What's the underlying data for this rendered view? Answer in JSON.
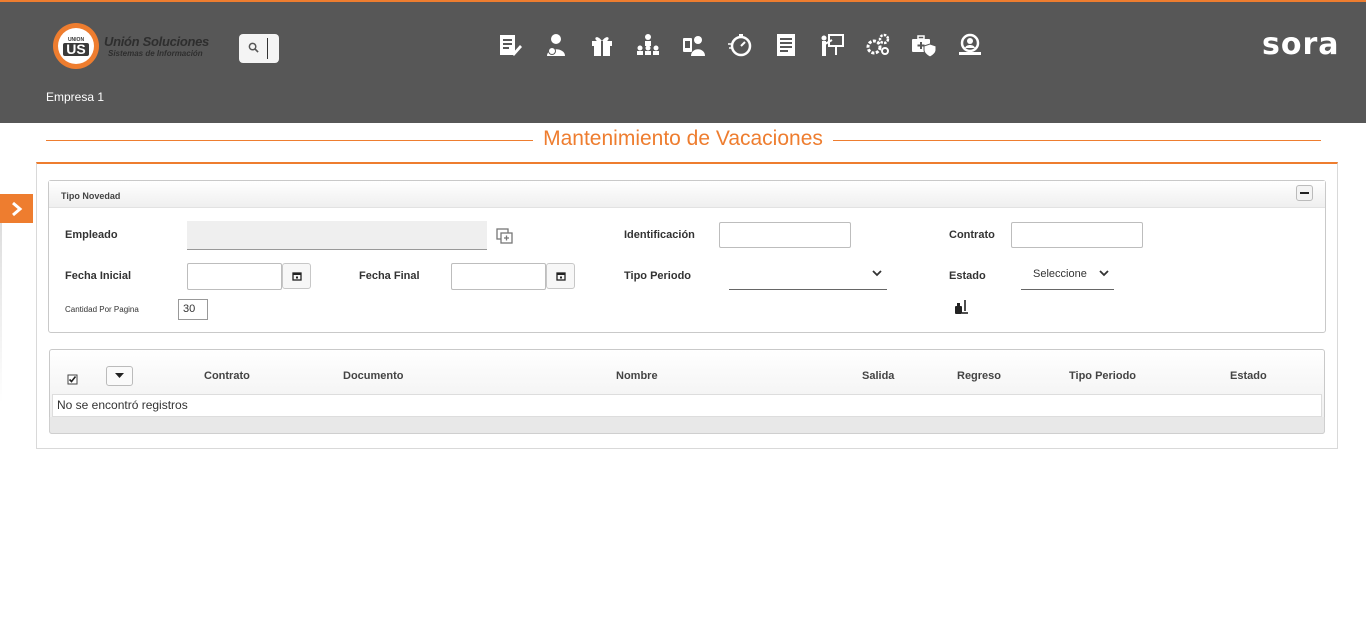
{
  "header": {
    "logo": {
      "badge_small": "UNION",
      "badge_main": "US",
      "title": "Unión Soluciones",
      "subtitle": "Sistemas de Información"
    },
    "brand": "sora",
    "company": "Empresa 1",
    "nav_icons": [
      "document-edit-icon",
      "user-money-icon",
      "gift-icon",
      "org-chart-icon",
      "person-phone-icon",
      "stopwatch-icon",
      "report-list-icon",
      "presentation-icon",
      "gears-icon",
      "medical-shield-icon",
      "search-people-icon"
    ]
  },
  "page": {
    "title": "Mantenimiento de Vacaciones"
  },
  "filter_panel": {
    "title": "Tipo Novedad",
    "labels": {
      "empleado": "Empleado",
      "identificacion": "Identificación",
      "contrato": "Contrato",
      "fecha_inicial": "Fecha Inicial",
      "fecha_final": "Fecha Final",
      "tipo_periodo": "Tipo Periodo",
      "estado": "Estado",
      "cantidad_por_pagina": "Cantidad Por Pagina"
    },
    "values": {
      "estado_selected": "Seleccione",
      "tipo_periodo_selected": "",
      "cantidad_por_pagina": "30"
    }
  },
  "grid": {
    "columns": [
      "Contrato",
      "Documento",
      "Nombre",
      "Salida",
      "Regreso",
      "Tipo Periodo",
      "Estado"
    ],
    "empty_message": "No se encontró registros"
  },
  "colors": {
    "accent": "#ee7d2f",
    "header_bg": "#575757"
  }
}
